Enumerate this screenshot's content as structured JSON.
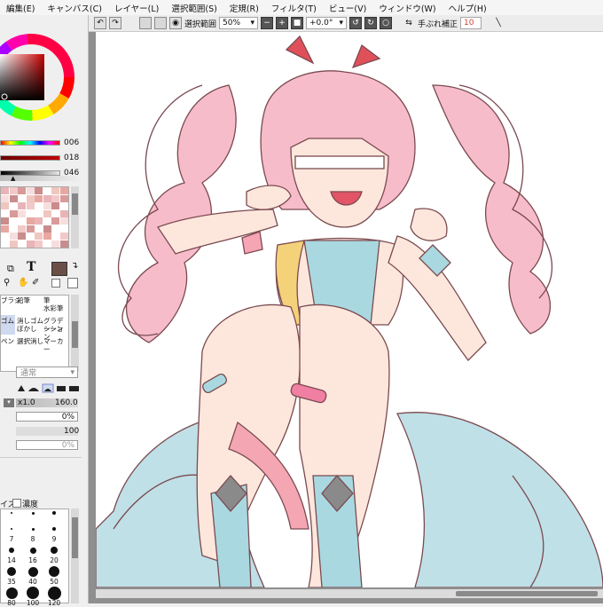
{
  "menu": {
    "items": [
      "編集(E)",
      "キャンバス(C)",
      "レイヤー(L)",
      "選択範囲(S)",
      "定規(R)",
      "フィルタ(T)",
      "ビュー(V)",
      "ウィンドウ(W)",
      "ヘルプ(H)"
    ]
  },
  "toolbar": {
    "selection_label": "選択範囲",
    "zoom_value": "50%",
    "rotation_value": "+0.0°",
    "stabilizer_label": "手ぶれ補正",
    "stabilizer_value": "10"
  },
  "color_panel": {
    "slider_values": [
      "006",
      "018",
      "046"
    ],
    "main_color": "#6b4f47"
  },
  "tools": {
    "cells": [
      "ブラシ",
      "鉛筆",
      "筆",
      "水彩筆",
      "ゴム",
      "消しゴム",
      "グラデーション",
      "マーカー",
      "選択消し",
      "ぼかし",
      "ペン",
      "シーン"
    ]
  },
  "brush_props": {
    "blend_mode": "通常",
    "size_multiplier": "x1.0",
    "size_value": "160.0",
    "min_size": "0%",
    "density": "100",
    "min_density": "0%",
    "size_label": "イズ",
    "density_label": "濃度",
    "preset_sizes": [
      "7",
      "8",
      "9",
      "14",
      "16",
      "20",
      "35",
      "40",
      "50",
      "80",
      "100",
      "120"
    ]
  },
  "accent_color": "#e88fa0"
}
